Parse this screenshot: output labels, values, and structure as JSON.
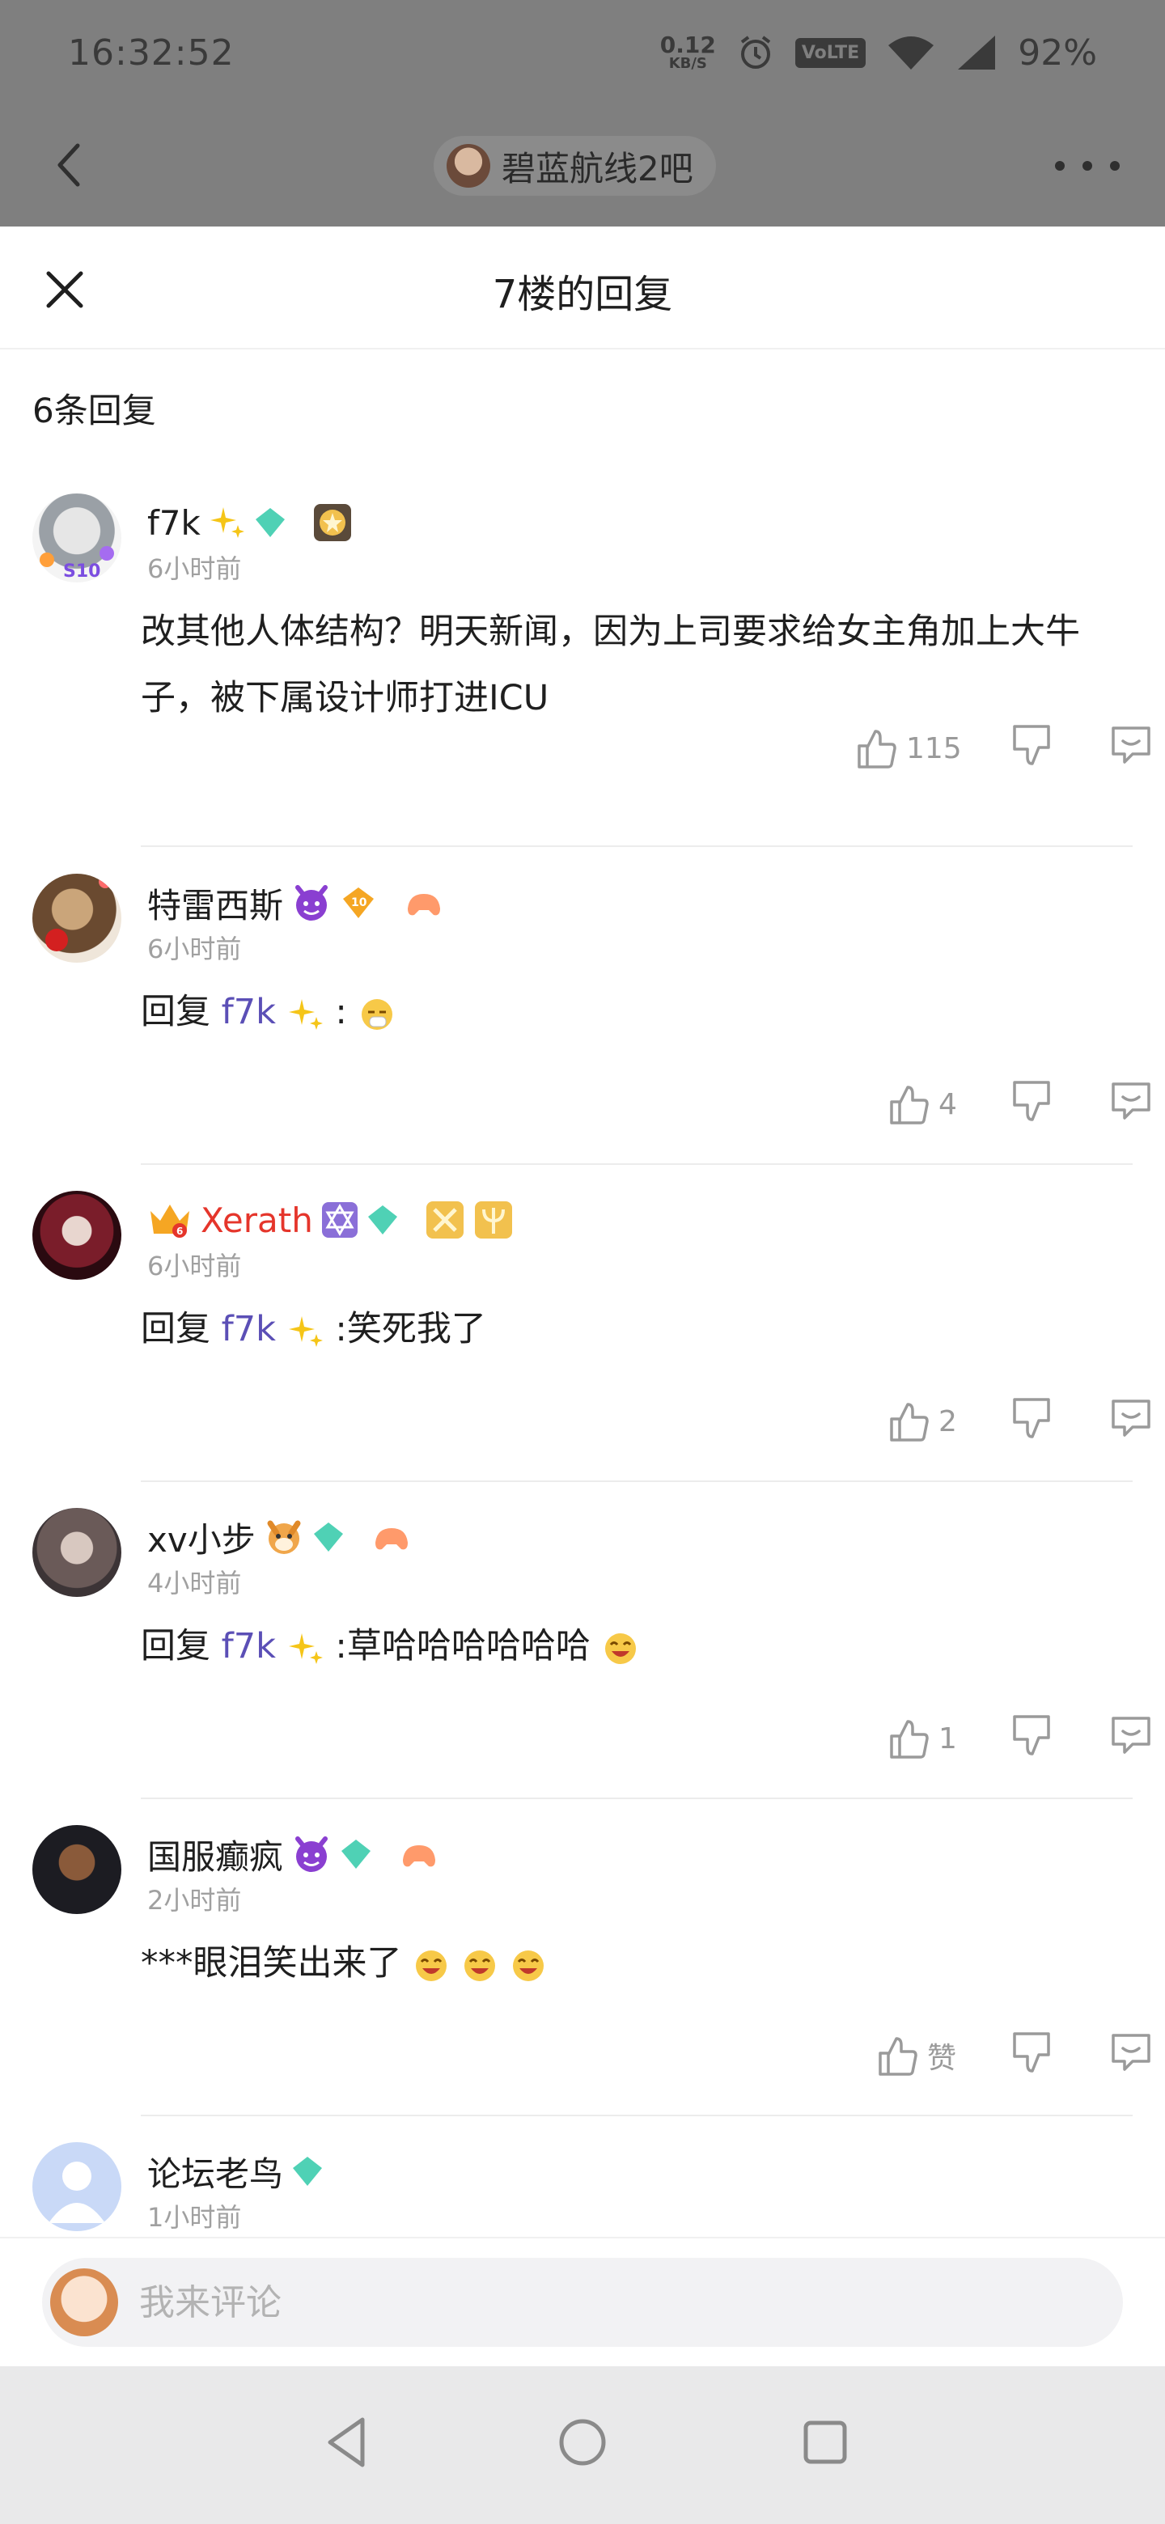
{
  "status_bar": {
    "time": "16:32:52",
    "net_speed_value": "0.12",
    "net_speed_unit": "KB/S",
    "volte": "VoLTE",
    "battery": "92%"
  },
  "nav": {
    "forum_name": "碧蓝航线2吧"
  },
  "sheet": {
    "title": "7楼的回复",
    "reply_count": "6条回复"
  },
  "comments": [
    {
      "username": "f7k",
      "time": "6小时前",
      "content": "改其他人体结构？明天新闻，因为上司要求给女主角加上大牛子，被下属设计师打进ICU",
      "likes": "115",
      "diamond_level": "1"
    },
    {
      "username": "特雷西斯",
      "time": "6小时前",
      "reply_prefix": "回复",
      "reply_to": "f7k",
      "content": " :",
      "likes": "4",
      "gold_level": "10"
    },
    {
      "username": "Xerath",
      "time": "6小时前",
      "reply_prefix": "回复",
      "reply_to": "f7k",
      "content": " :笑死我了",
      "likes": "2",
      "diamond_level": "1",
      "crown_level": "6"
    },
    {
      "username": "xv小步",
      "time": "4小时前",
      "reply_prefix": "回复",
      "reply_to": "f7k",
      "content": " :草哈哈哈哈哈哈",
      "likes": "1",
      "diamond_level": "1"
    },
    {
      "username": "国服癫疯",
      "time": "2小时前",
      "content": "***眼泪笑出来了",
      "likes": "赞",
      "diamond_level": "1"
    },
    {
      "username": "论坛老鸟",
      "time": "1小时前",
      "diamond_level": "1"
    }
  ],
  "input": {
    "placeholder": "我来评论"
  },
  "colors": {
    "link": "#5b4fb6",
    "vip_name": "#e5352b",
    "secondary_text": "#a0a0a0",
    "divider": "#ececec"
  }
}
